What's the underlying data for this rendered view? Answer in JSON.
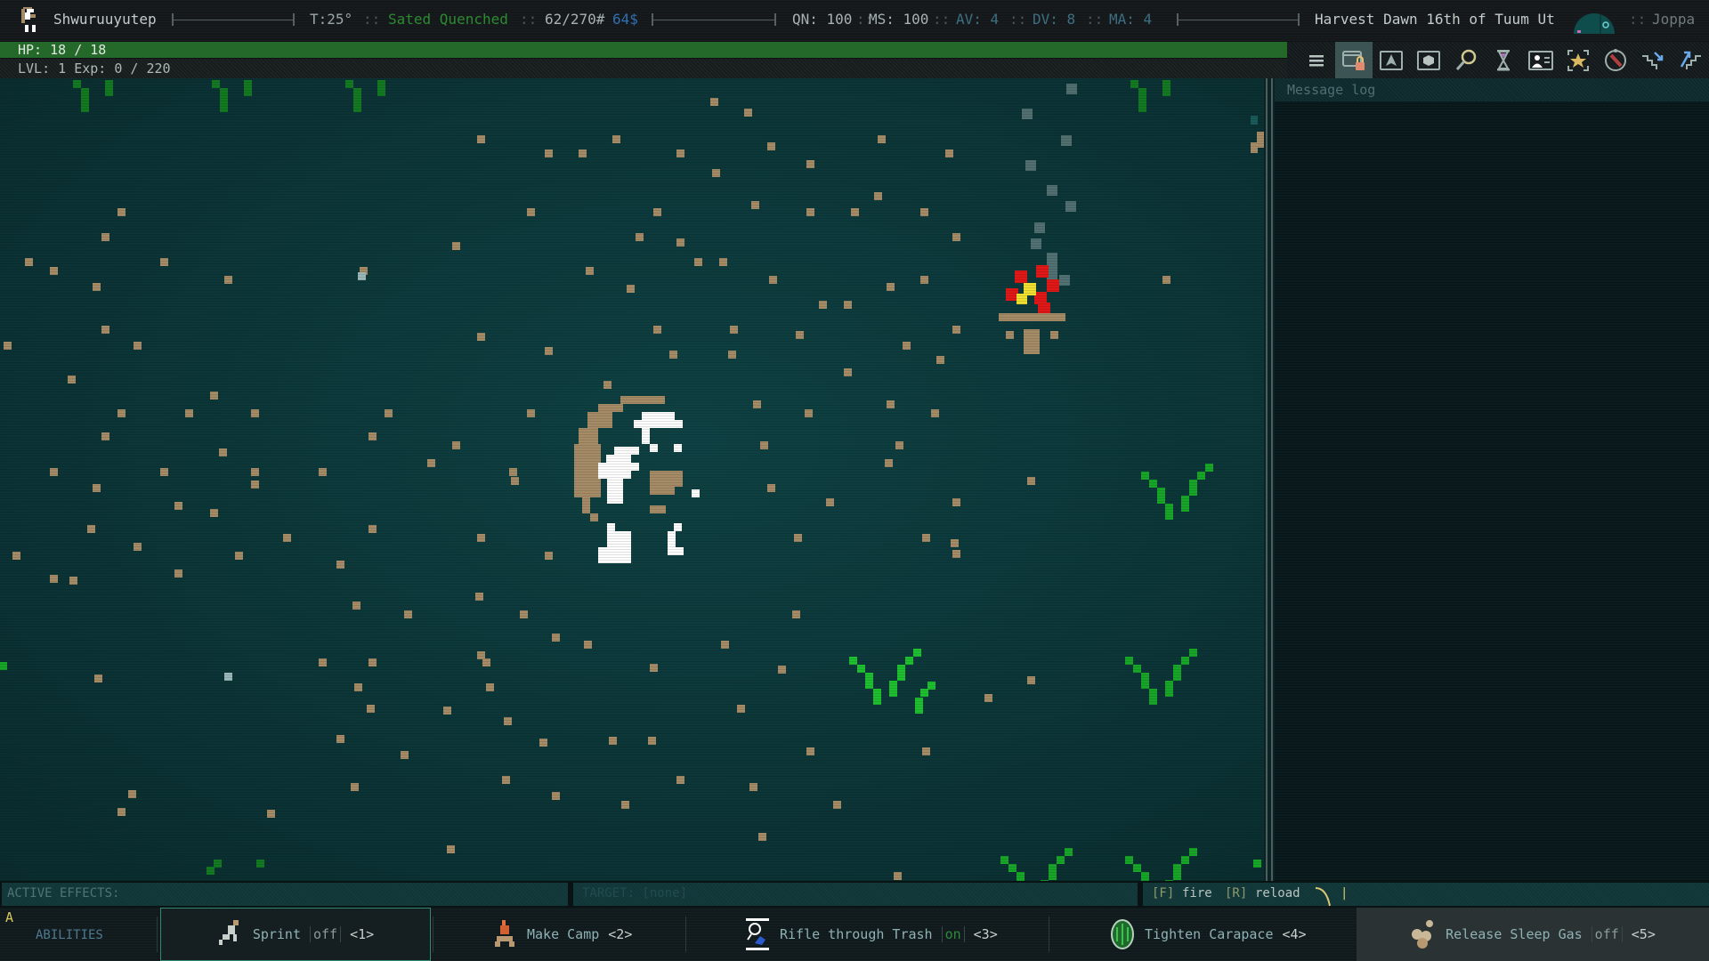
{
  "topbar": {
    "player_name": "Shwuruuyutep",
    "temperature": "T:25°",
    "hunger_thirst": "Sated Quenched",
    "weight": "62/270#",
    "money": "64$",
    "quickness": "QN: 100",
    "move_speed": "MS: 100",
    "armor_value": "AV: 4",
    "dodge_value": "DV: 8",
    "mental_armor": "MA: 4",
    "date": "Harvest Dawn 16th of Tuum Ut",
    "location": "Joppa",
    "separator": "::"
  },
  "status": {
    "hp_label": "HP: 18 / 18",
    "hp_fraction": 1.0,
    "level_label": "LVL: 1 Exp: 0 / 220"
  },
  "toolbar": {
    "items": [
      {
        "name": "menu",
        "icon": "hamburger-icon"
      },
      {
        "name": "equipment",
        "icon": "window-lock-icon",
        "active": true
      },
      {
        "name": "character",
        "icon": "arrow-up-icon"
      },
      {
        "name": "inventory",
        "icon": "cube-icon"
      },
      {
        "name": "look",
        "icon": "magnifier-icon"
      },
      {
        "name": "wait",
        "icon": "hourglass-icon"
      },
      {
        "name": "journal",
        "icon": "id-card-icon"
      },
      {
        "name": "abilities",
        "icon": "star-target-icon"
      },
      {
        "name": "auto-explore",
        "icon": "compass-icon"
      },
      {
        "name": "descend",
        "icon": "stairs-down-icon"
      },
      {
        "name": "ascend",
        "icon": "stairs-up-icon"
      }
    ]
  },
  "message_log": {
    "title": "Message log"
  },
  "effects": {
    "active_effects_label": "ACTIVE EFFECTS:",
    "target_label": "TARGET: [none]",
    "fire_key": "[F]",
    "fire_label": "fire",
    "reload_key": "[R]",
    "reload_label": "reload",
    "cursor": "|"
  },
  "abilities": {
    "hotkey": "A",
    "label": "ABILITIES",
    "items": [
      {
        "name": "Sprint",
        "state": "off",
        "key": "<1>",
        "icon": "sprint-icon",
        "selected": true
      },
      {
        "name": "Make Camp",
        "state": null,
        "key": "<2>",
        "icon": "campfire-icon"
      },
      {
        "name": "Rifle through Trash",
        "state": "on",
        "key": "<3>",
        "icon": "rifle-trash-icon"
      },
      {
        "name": "Tighten Carapace",
        "state": null,
        "key": "<4>",
        "icon": "carapace-icon"
      },
      {
        "name": "Release Sleep Gas",
        "state": "off",
        "key": "<5>",
        "icon": "sleep-gas-icon",
        "highlighted": true
      }
    ]
  },
  "colors": {
    "hp_bar": "#24682a",
    "sated_text": "#2c8a30",
    "money_text": "#2f6fb0",
    "stat_blue": "#3d6f82",
    "map_bg": "#0c3638",
    "dirt": "#a58c66",
    "grass": "#18b02a"
  }
}
